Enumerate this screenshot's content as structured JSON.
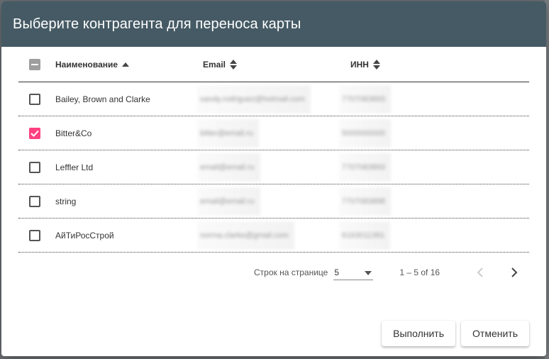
{
  "dialog": {
    "title": "Выберите контрагента для переноса карты"
  },
  "table": {
    "columns": {
      "name": "Наименование",
      "email": "Email",
      "inn": "ИНН"
    },
    "rows": [
      {
        "name": "Bailey, Brown and Clarke",
        "email": "sandy.rodriguez@hotmail.com",
        "inn": "7707083893",
        "checked": false
      },
      {
        "name": "Bitter&Co",
        "email": "bitter@email.ru",
        "inn": "5000000000",
        "checked": true
      },
      {
        "name": "Leffler Ltd",
        "email": "email@email.ru",
        "inn": "7707083893",
        "checked": false
      },
      {
        "name": "string",
        "email": "email@email.ru",
        "inn": "7707083898",
        "checked": false
      },
      {
        "name": "АйТиРосСтрой",
        "email": "norma.clarke@gmail.com",
        "inn": "6163011391",
        "checked": false
      }
    ]
  },
  "paginator": {
    "label": "Строк на странице",
    "page_size": "5",
    "range": "1 – 5 of 16"
  },
  "actions": {
    "submit": "Выполнить",
    "cancel": "Отменить"
  },
  "colors": {
    "header_bg": "#455a64",
    "accent_checkbox": "#ff4081"
  }
}
